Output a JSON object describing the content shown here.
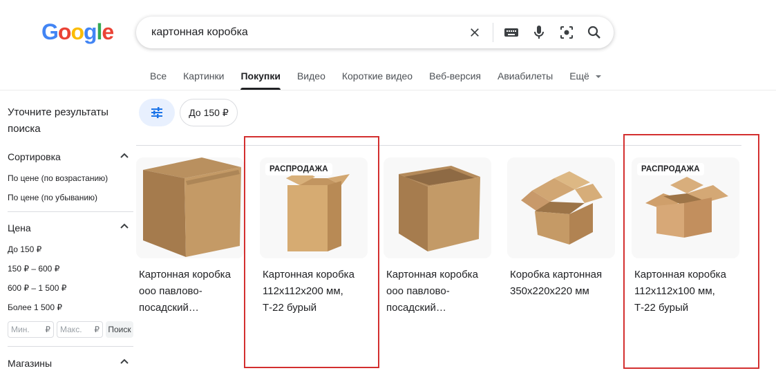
{
  "logo": {
    "text": "Google"
  },
  "search": {
    "query": "картонная коробка"
  },
  "icons": {
    "clear": "close-icon",
    "keyboard": "keyboard-icon",
    "mic": "mic-icon",
    "lens": "lens-icon",
    "search": "search-icon",
    "filter": "tune-icon"
  },
  "tabs": [
    {
      "label": "Все",
      "active": false
    },
    {
      "label": "Картинки",
      "active": false
    },
    {
      "label": "Покупки",
      "active": true
    },
    {
      "label": "Видео",
      "active": false
    },
    {
      "label": "Короткие видео",
      "active": false
    },
    {
      "label": "Веб-версия",
      "active": false
    },
    {
      "label": "Авиабилеты",
      "active": false
    },
    {
      "label": "Ещё",
      "active": false
    }
  ],
  "sidebar": {
    "title": "Уточните результаты поиска",
    "sort": {
      "heading": "Сортировка",
      "options": [
        "По цене (по возрастанию)",
        "По цене (по убыванию)"
      ]
    },
    "price": {
      "heading": "Цена",
      "options": [
        "До 150 ₽",
        "150 ₽ – 600 ₽",
        "600 ₽ – 1 500 ₽",
        "Более 1 500 ₽"
      ],
      "min_placeholder": "Мин.",
      "max_placeholder": "Макс.",
      "currency": "₽",
      "search_label": "Поиск"
    },
    "stores": {
      "heading": "Магазины"
    }
  },
  "chips": {
    "price_chip": "До 150 ₽"
  },
  "products": [
    {
      "title": "Картонная коробка ооо павлово-посадский…",
      "badge": ""
    },
    {
      "title": "Картонная коробка 112x112x200 мм, Т-22 бурый",
      "badge": "РАСПРОДАЖА"
    },
    {
      "title": "Картонная коробка ооо павлово-посадский…",
      "badge": ""
    },
    {
      "title": "Коробка картонная 350x220x220 мм",
      "badge": ""
    },
    {
      "title": "Картонная коробка 112x112x100 мм, Т-22 бурый",
      "badge": "РАСПРОДАЖА"
    }
  ],
  "colors": {
    "accent": "#1a73e8",
    "highlight_box": "#d32f2f",
    "cardboard": "#c8a06a"
  }
}
